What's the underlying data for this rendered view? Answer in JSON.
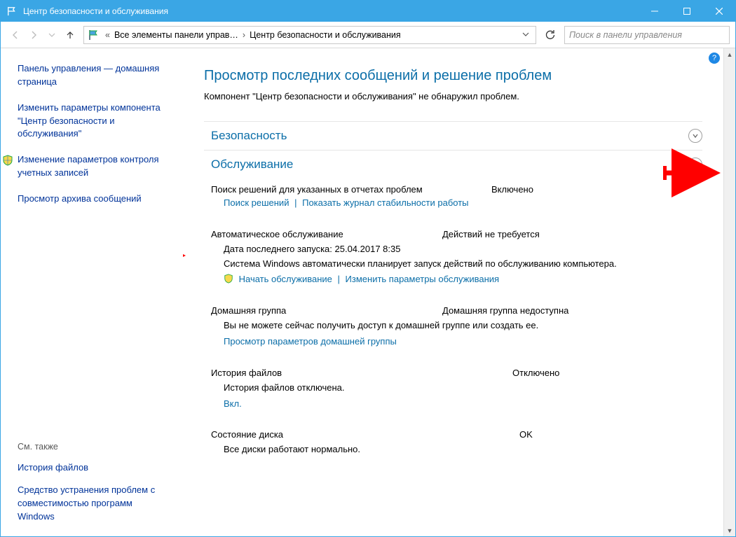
{
  "window": {
    "title": "Центр безопасности и обслуживания"
  },
  "toolbar": {
    "breadcrumb1": "Все элементы панели управ…",
    "breadcrumb2": "Центр безопасности и обслуживания",
    "search_placeholder": "Поиск в панели управления"
  },
  "sidebar": {
    "links": [
      "Панель управления — домашняя страница",
      "Изменить параметры компонента \"Центр безопасности и обслуживания\"",
      "Изменение параметров контроля учетных записей",
      "Просмотр архива сообщений"
    ],
    "see_also_label": "См. также",
    "see_also_links": [
      "История файлов",
      "Средство устранения проблем с совместимостью программ Windows"
    ]
  },
  "main": {
    "heading": "Просмотр последних сообщений и решение проблем",
    "subtitle": "Компонент \"Центр безопасности и обслуживания\" не обнаружил проблем.",
    "section_security": "Безопасность",
    "section_maintenance": "Обслуживание",
    "items": {
      "reports": {
        "label": "Поиск решений для указанных в отчетах проблем",
        "status": "Включено",
        "link1": "Поиск решений",
        "link2": "Показать журнал стабильности работы"
      },
      "auto": {
        "label": "Автоматическое обслуживание",
        "status": "Действий не требуется",
        "line1": "Дата последнего запуска: 25.04.2017 8:35",
        "line2": "Система Windows автоматически планирует запуск действий по обслуживанию компьютера.",
        "link1": "Начать обслуживание",
        "link2": "Изменить параметры обслуживания"
      },
      "homegroup": {
        "label": "Домашняя группа",
        "status": "Домашняя группа недоступна",
        "line": "Вы не можете сейчас получить доступ к домашней группе или создать ее.",
        "link": "Просмотр параметров домашней группы"
      },
      "filehist": {
        "label": "История файлов",
        "status": "Отключено",
        "line": "История файлов отключена.",
        "link": "Вкл."
      },
      "disk": {
        "label": "Состояние диска",
        "status": "OK",
        "line": "Все диски работают нормально."
      }
    }
  }
}
